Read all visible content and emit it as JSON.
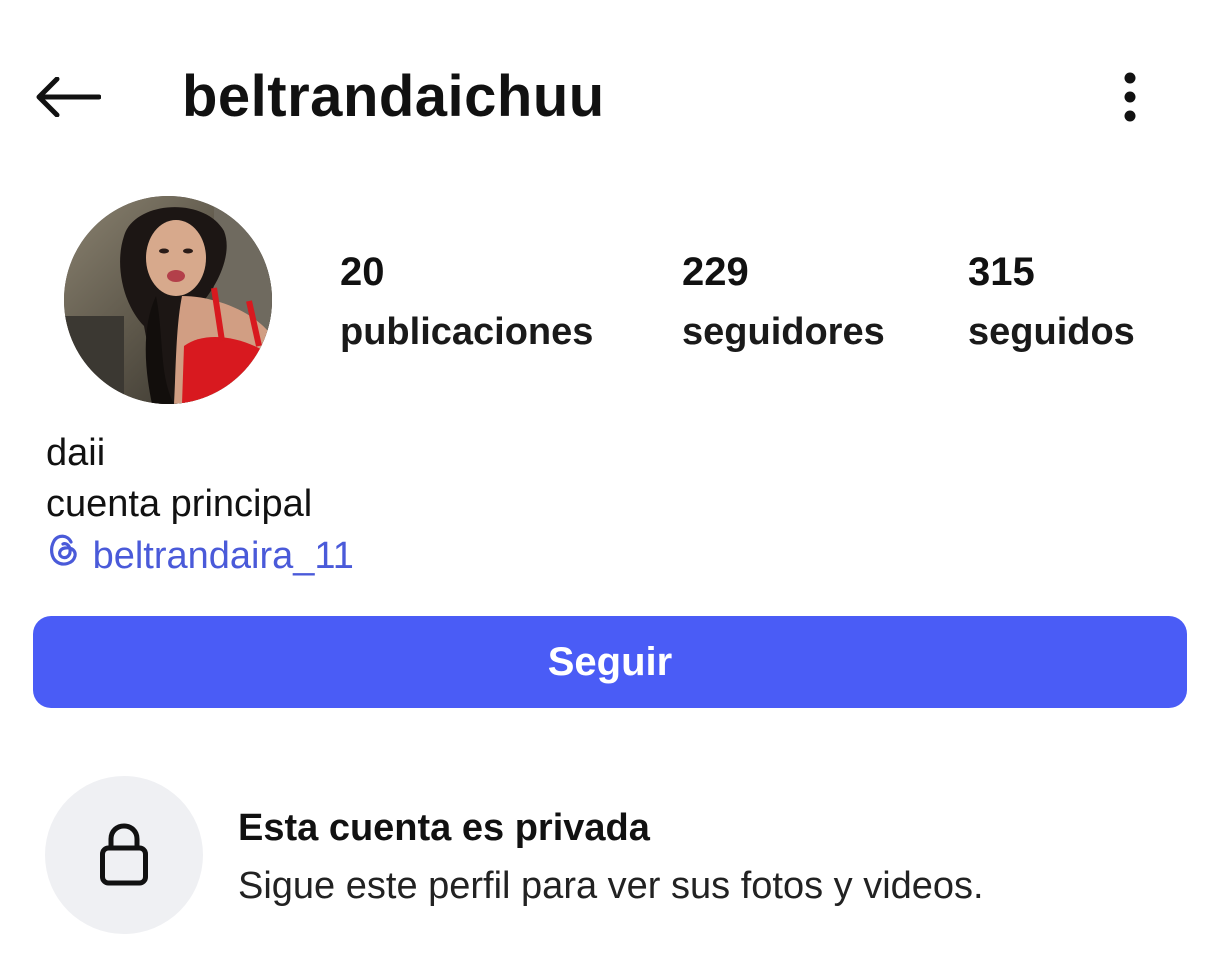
{
  "header": {
    "username": "beltrandaichuu",
    "back_icon": "arrow-left-icon",
    "more_icon": "more-vertical-icon"
  },
  "profile": {
    "avatar_icon": "profile-photo",
    "stats": {
      "posts": {
        "value": "20",
        "label": "publicaciones"
      },
      "followers": {
        "value": "229",
        "label": "seguidores"
      },
      "following": {
        "value": "315",
        "label": "seguidos"
      }
    },
    "bio": {
      "name": "daii",
      "description": "cuenta principal",
      "threads_handle": "beltrandaira_11",
      "threads_icon": "threads-icon"
    }
  },
  "actions": {
    "follow_label": "Seguir",
    "follow_color": "#4a5cf6"
  },
  "private_notice": {
    "icon": "lock-icon",
    "title": "Esta cuenta es privada",
    "subtitle": "Sigue este perfil para ver sus fotos y videos."
  },
  "colors": {
    "link": "#4a5ad9",
    "private_circle_bg": "#eff0f3"
  }
}
